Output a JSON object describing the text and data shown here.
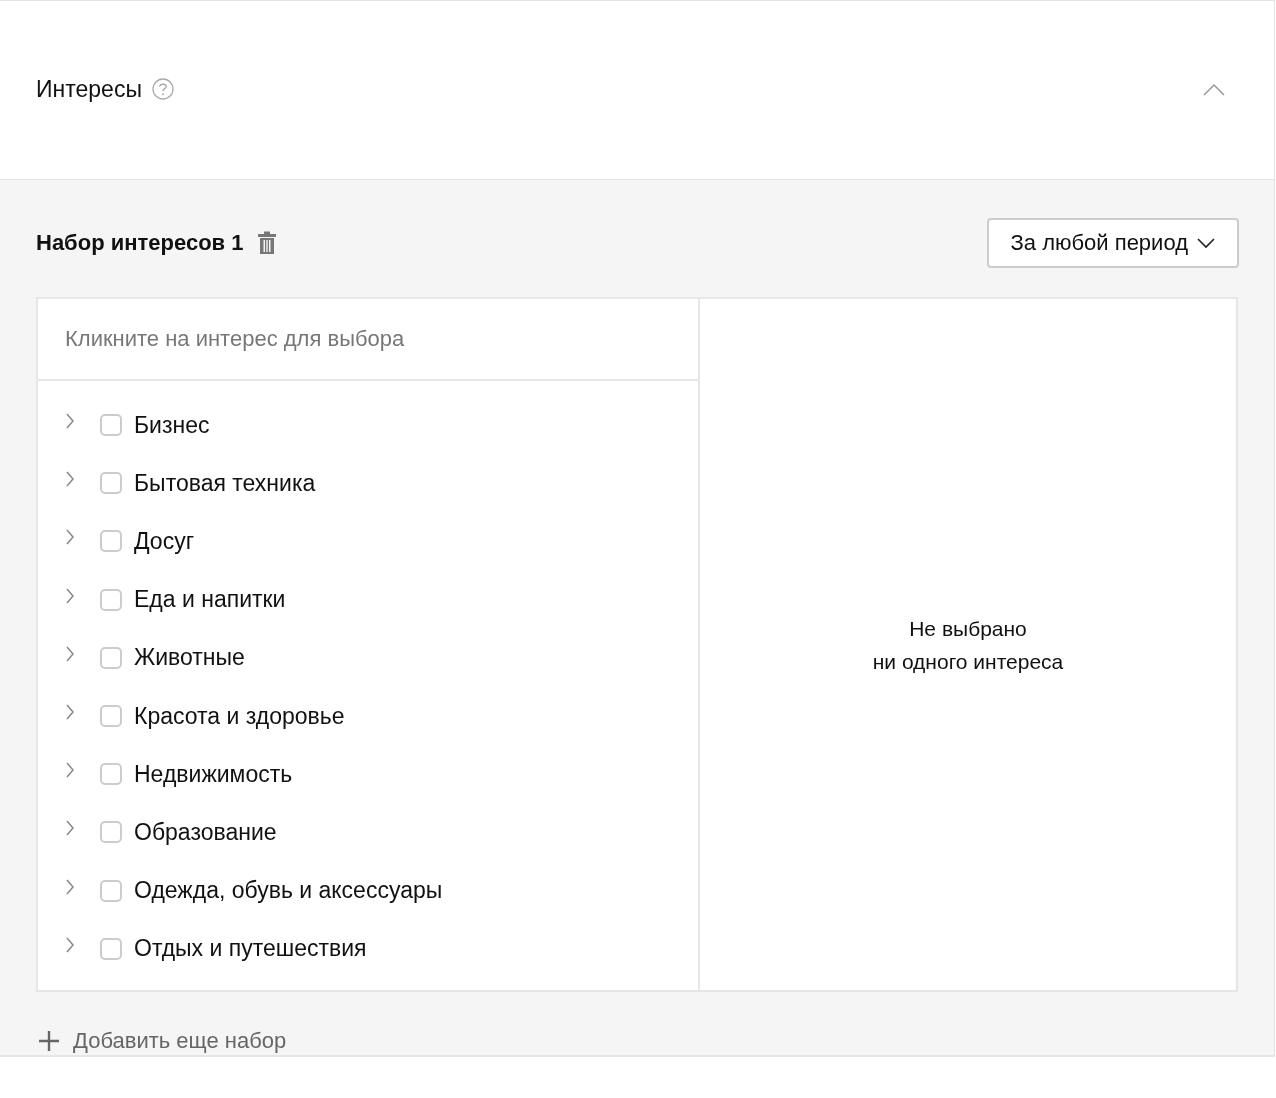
{
  "section": {
    "title": "Интересы",
    "expanded": true
  },
  "interest_set": {
    "title": "Набор интересов 1",
    "period": "За любой период"
  },
  "picker": {
    "hint": "Кликните на интерес для выбора",
    "items": [
      {
        "label": "Бизнес",
        "checked": false,
        "expanded": false
      },
      {
        "label": "Бытовая техника",
        "checked": false,
        "expanded": false
      },
      {
        "label": "Досуг",
        "checked": false,
        "expanded": false
      },
      {
        "label": "Еда и напитки",
        "checked": false,
        "expanded": false
      },
      {
        "label": "Животные",
        "checked": false,
        "expanded": false
      },
      {
        "label": "Красота и здоровье",
        "checked": false,
        "expanded": false
      },
      {
        "label": "Недвижимость",
        "checked": false,
        "expanded": false
      },
      {
        "label": "Образование",
        "checked": false,
        "expanded": false
      },
      {
        "label": "Одежда, обувь и аксессуары",
        "checked": false,
        "expanded": false
      },
      {
        "label": "Отдых и путешествия",
        "checked": false,
        "expanded": false
      }
    ]
  },
  "selection": {
    "empty_lines": [
      "Не выбрано",
      "ни одного интереса"
    ]
  },
  "add_set": "Добавить еще набор"
}
